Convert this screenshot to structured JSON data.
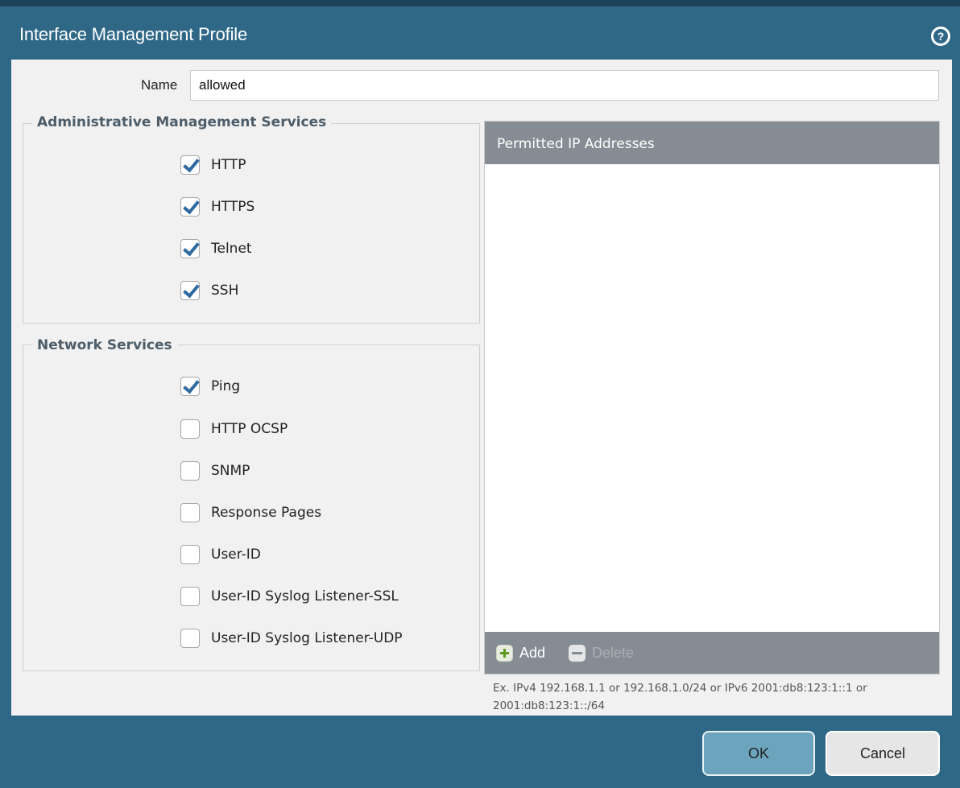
{
  "dialog": {
    "title": "Interface Management Profile",
    "help_icon": "help-circle-icon"
  },
  "name_field": {
    "label": "Name",
    "value": "allowed"
  },
  "admin_services": {
    "legend": "Administrative Management Services",
    "items": [
      {
        "label": "HTTP",
        "checked": true
      },
      {
        "label": "HTTPS",
        "checked": true
      },
      {
        "label": "Telnet",
        "checked": true
      },
      {
        "label": "SSH",
        "checked": true
      }
    ]
  },
  "network_services": {
    "legend": "Network Services",
    "items": [
      {
        "label": "Ping",
        "checked": true
      },
      {
        "label": "HTTP OCSP",
        "checked": false
      },
      {
        "label": "SNMP",
        "checked": false
      },
      {
        "label": "Response Pages",
        "checked": false
      },
      {
        "label": "User-ID",
        "checked": false
      },
      {
        "label": "User-ID Syslog Listener-SSL",
        "checked": false
      },
      {
        "label": "User-ID Syslog Listener-UDP",
        "checked": false
      }
    ]
  },
  "permitted_ips": {
    "header": "Permitted IP Addresses",
    "rows": [],
    "add_label": "Add",
    "add_icon": "plus-icon",
    "delete_label": "Delete",
    "delete_icon": "minus-icon",
    "hint": "Ex. IPv4 192.168.1.1 or 192.168.1.0/24 or IPv6 2001:db8:123:1::1 or 2001:db8:123:1::/64"
  },
  "footer": {
    "ok_label": "OK",
    "cancel_label": "Cancel"
  },
  "colors": {
    "titlebar": "#2f6887",
    "body": "#f1f1f1",
    "grid_header": "#858c93",
    "checkmark": "#2f6aa0",
    "ok_button": "#6ca4bd"
  }
}
